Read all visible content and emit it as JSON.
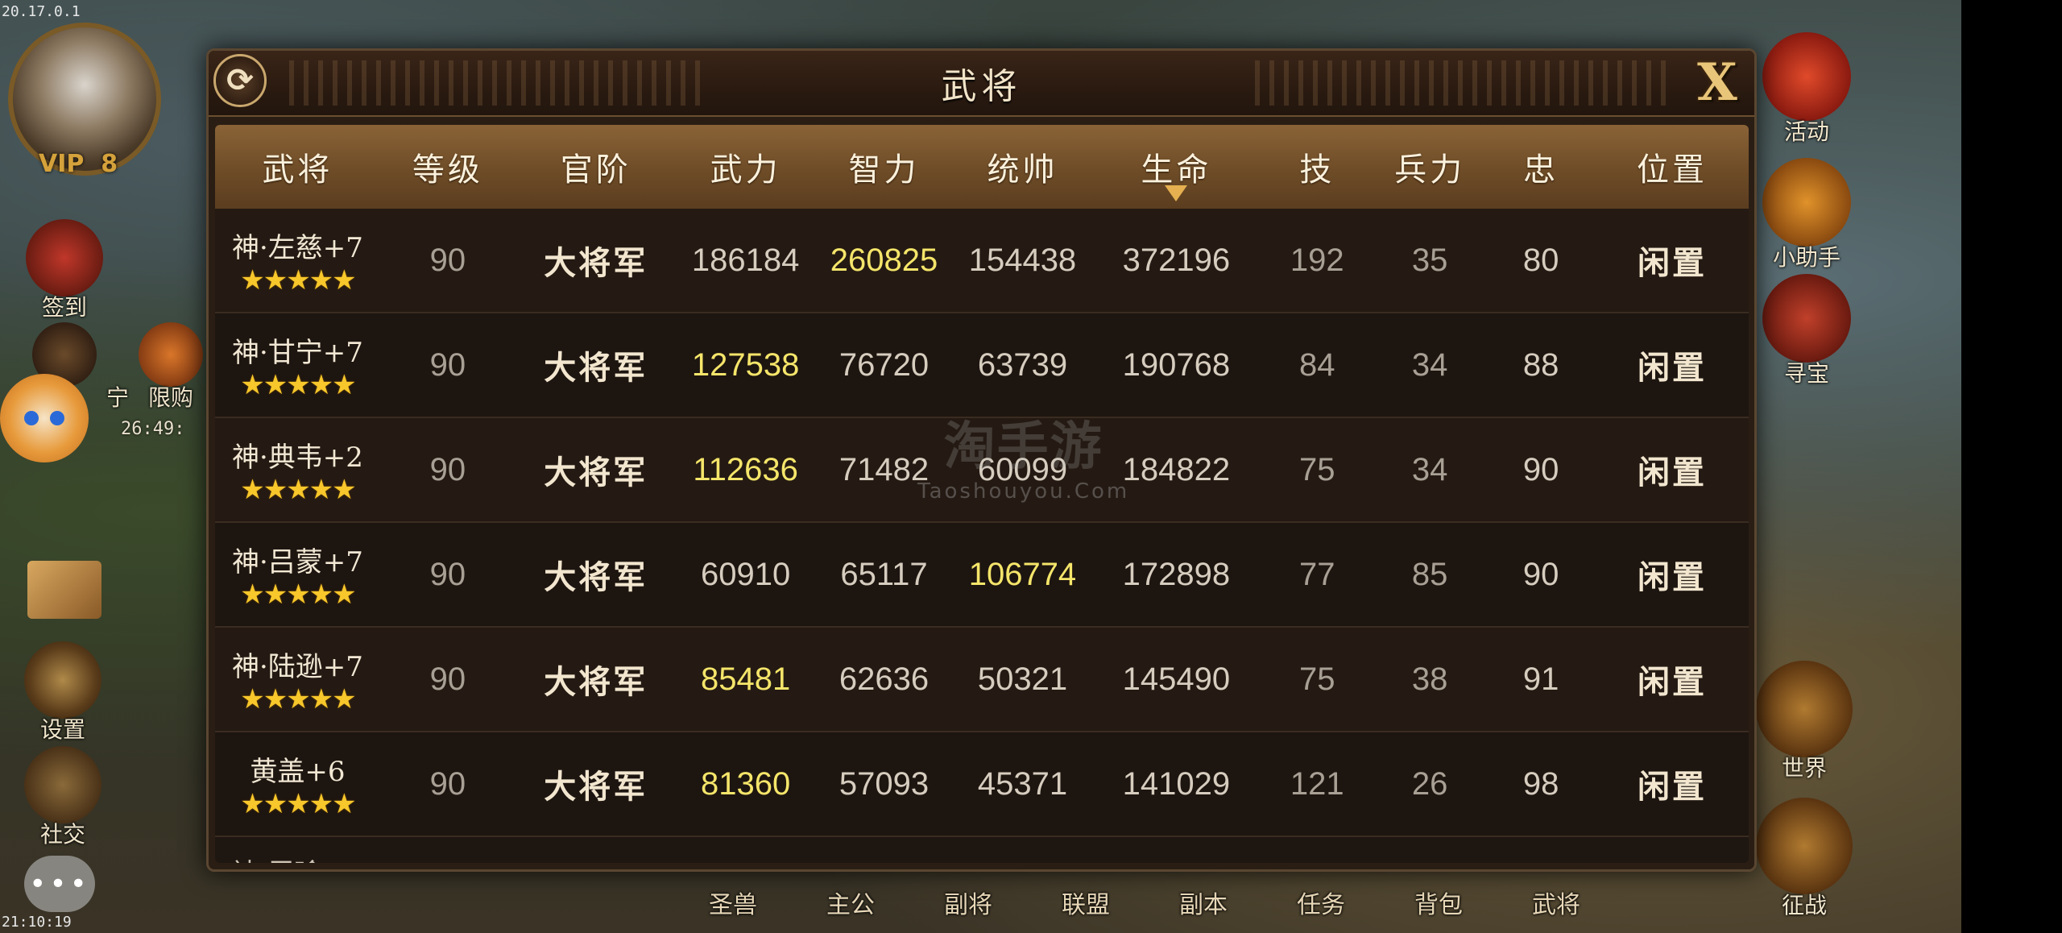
{
  "status_bar": {
    "top": "20.17.0.1",
    "bottom": "21:10:19"
  },
  "hud": {
    "vip_label": "VIP",
    "vip_level": "8",
    "timer": "26:49:",
    "left_buttons": [
      "签到",
      "宁",
      "限购",
      "设置",
      "社交"
    ],
    "right_buttons": [
      "活动",
      "小助手",
      "寻宝",
      "世界",
      "征战"
    ],
    "bottom_menu": [
      "圣兽",
      "主公",
      "副将",
      "联盟",
      "副本",
      "任务",
      "背包",
      "武将"
    ]
  },
  "panel": {
    "title": "武将",
    "refresh_icon": "refresh-icon",
    "close_icon": "close-x-icon",
    "columns": [
      "武将",
      "等级",
      "官阶",
      "武力",
      "智力",
      "统帅",
      "生命",
      "技",
      "兵力",
      "忠",
      "位置"
    ],
    "sorted_column": "生命",
    "rows": [
      {
        "name": "神·左慈+7",
        "stars": 5,
        "level": "90",
        "rank": "大将军",
        "force": "186184",
        "intellect": "260825",
        "command": "154438",
        "hp": "372196",
        "skill": "192",
        "troops": "35",
        "loyalty": "80",
        "position": "闲置",
        "highlight": "intellect"
      },
      {
        "name": "神·甘宁+7",
        "stars": 5,
        "level": "90",
        "rank": "大将军",
        "force": "127538",
        "intellect": "76720",
        "command": "63739",
        "hp": "190768",
        "skill": "84",
        "troops": "34",
        "loyalty": "88",
        "position": "闲置",
        "highlight": "force"
      },
      {
        "name": "神·典韦+2",
        "stars": 5,
        "level": "90",
        "rank": "大将军",
        "force": "112636",
        "intellect": "71482",
        "command": "60099",
        "hp": "184822",
        "skill": "75",
        "troops": "34",
        "loyalty": "90",
        "position": "闲置",
        "highlight": "force"
      },
      {
        "name": "神·吕蒙+7",
        "stars": 5,
        "level": "90",
        "rank": "大将军",
        "force": "60910",
        "intellect": "65117",
        "command": "106774",
        "hp": "172898",
        "skill": "77",
        "troops": "85",
        "loyalty": "90",
        "position": "闲置",
        "highlight": "command"
      },
      {
        "name": "神·陆逊+7",
        "stars": 5,
        "level": "90",
        "rank": "大将军",
        "force": "85481",
        "intellect": "62636",
        "command": "50321",
        "hp": "145490",
        "skill": "75",
        "troops": "38",
        "loyalty": "91",
        "position": "闲置",
        "highlight": "force"
      },
      {
        "name": "黄盖+6",
        "stars": 5,
        "level": "90",
        "rank": "大将军",
        "force": "81360",
        "intellect": "57093",
        "command": "45371",
        "hp": "141029",
        "skill": "121",
        "troops": "26",
        "loyalty": "98",
        "position": "闲置",
        "highlight": "force"
      }
    ]
  },
  "watermark": {
    "main": "淘手游",
    "sub": "Taoshouyou.Com"
  }
}
